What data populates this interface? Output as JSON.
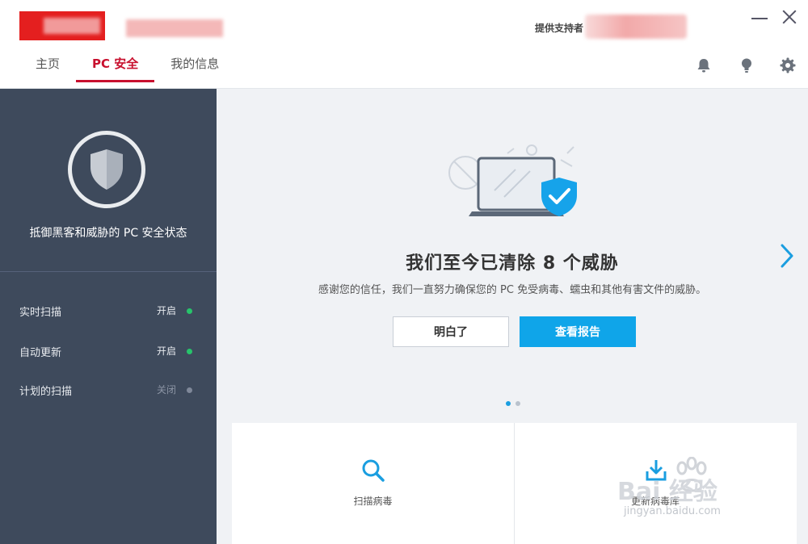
{
  "header": {
    "sponsor_label": "提供支持者",
    "tabs": [
      {
        "label": "主页",
        "active": false
      },
      {
        "label": "PC 安全",
        "active": true
      },
      {
        "label": "我的信息",
        "active": false
      }
    ],
    "icons": [
      "bell-icon",
      "lightbulb-icon",
      "gear-icon"
    ],
    "window_controls": [
      "minimize-icon",
      "close-icon"
    ]
  },
  "sidebar": {
    "title": "抵御黑客和威胁的 PC 安全状态",
    "items": [
      {
        "label": "实时扫描",
        "state": "开启",
        "on": true
      },
      {
        "label": "自动更新",
        "state": "开启",
        "on": true
      },
      {
        "label": "计划的扫描",
        "state": "关闭",
        "on": false
      }
    ]
  },
  "main": {
    "title": "我们至今已清除 8 个威胁",
    "subtitle": "感谢您的信任，我们一直努力确保您的 PC 免受病毒、蠕虫和其他有害文件的威胁。",
    "ok_button": "明白了",
    "report_button": "查看报告",
    "pager": {
      "current": 1,
      "total": 2
    },
    "cards": [
      {
        "label": "扫描病毒",
        "icon": "search-icon"
      },
      {
        "label": "更新病毒库",
        "icon": "download-icon"
      }
    ]
  },
  "watermark": {
    "text_big": "Bai  经验",
    "text_small": "jingyan.baidu.com"
  },
  "colors": {
    "accent_red": "#c8102e",
    "primary_blue": "#0fa5e9",
    "sidebar_bg": "#3e4a5c",
    "status_on": "#27c46b"
  }
}
